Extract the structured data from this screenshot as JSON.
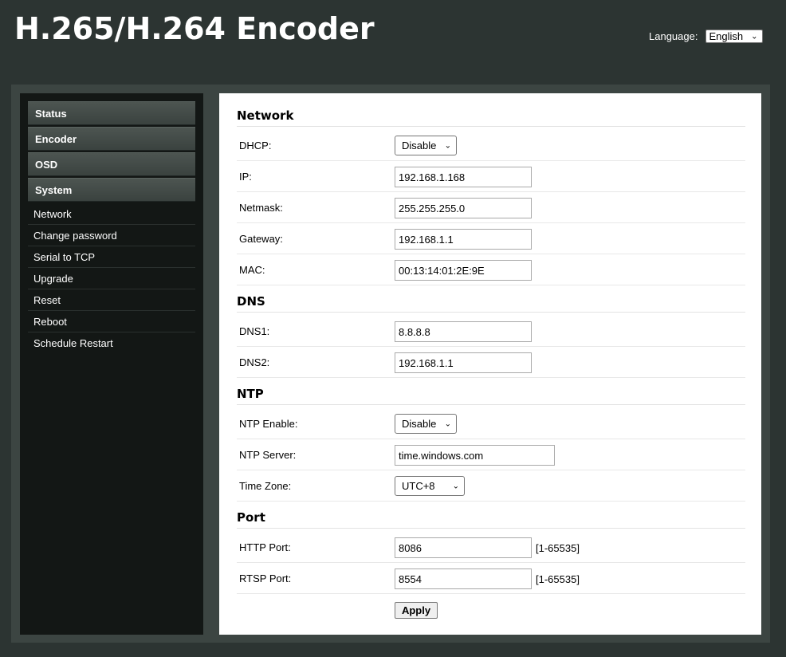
{
  "app": {
    "title": "H.265/H.264 Encoder"
  },
  "language": {
    "label": "Language:",
    "selected": "English"
  },
  "sidebar": {
    "headers": [
      "Status",
      "Encoder",
      "OSD",
      "System"
    ],
    "system_items": [
      "Network",
      "Change password",
      "Serial to TCP",
      "Upgrade",
      "Reset",
      "Reboot",
      "Schedule Restart"
    ]
  },
  "network": {
    "title": "Network",
    "dhcp": {
      "label": "DHCP:",
      "value": "Disable"
    },
    "ip": {
      "label": "IP:",
      "value": "192.168.1.168"
    },
    "netmask": {
      "label": "Netmask:",
      "value": "255.255.255.0"
    },
    "gateway": {
      "label": "Gateway:",
      "value": "192.168.1.1"
    },
    "mac": {
      "label": "MAC:",
      "value": "00:13:14:01:2E:9E"
    }
  },
  "dns": {
    "title": "DNS",
    "dns1": {
      "label": "DNS1:",
      "value": "8.8.8.8"
    },
    "dns2": {
      "label": "DNS2:",
      "value": "192.168.1.1"
    }
  },
  "ntp": {
    "title": "NTP",
    "enable": {
      "label": "NTP Enable:",
      "value": "Disable"
    },
    "server": {
      "label": "NTP Server:",
      "value": "time.windows.com"
    },
    "timezone": {
      "label": "Time Zone:",
      "value": "UTC+8"
    }
  },
  "port": {
    "title": "Port",
    "http": {
      "label": "HTTP Port:",
      "value": "8086",
      "range": "[1-65535]"
    },
    "rtsp": {
      "label": "RTSP Port:",
      "value": "8554",
      "range": "[1-65535]"
    }
  },
  "actions": {
    "apply_label": "Apply"
  }
}
